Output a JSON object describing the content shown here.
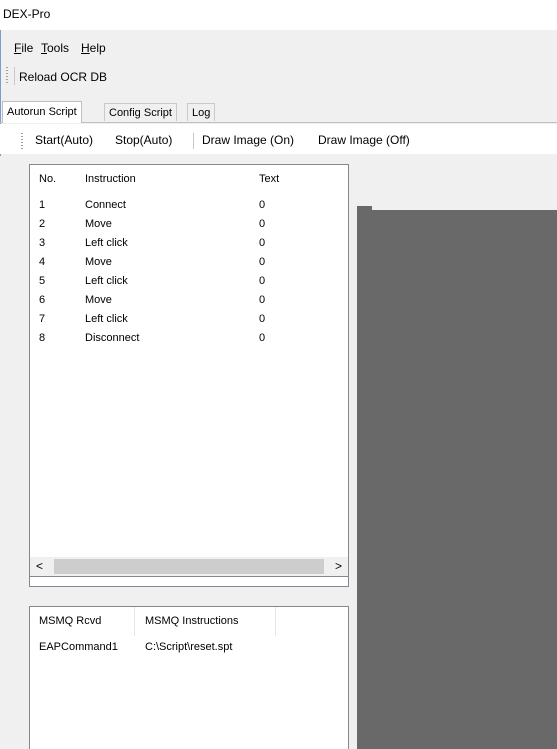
{
  "window": {
    "title": "DEX-Pro"
  },
  "menu": [
    {
      "accel": "F",
      "rest": "ile"
    },
    {
      "accel": "T",
      "rest": "ools"
    },
    {
      "accel": "H",
      "rest": "elp"
    }
  ],
  "toolbar_top": {
    "reload_label": "Reload OCR DB"
  },
  "tabs": [
    "Autorun Script",
    "Config Script",
    "Log"
  ],
  "active_tab": "Autorun Script",
  "script_toolbar": [
    "Start(Auto)",
    "Stop(Auto)",
    "Draw Image (On)",
    "Draw Image (Off)"
  ],
  "instruction_table": {
    "headers": {
      "no": "No.",
      "instruction": "Instruction",
      "text": "Text"
    },
    "rows": [
      {
        "no": "1",
        "instruction": "Connect",
        "text": "0"
      },
      {
        "no": "2",
        "instruction": "Move",
        "text": "0"
      },
      {
        "no": "3",
        "instruction": "Left click",
        "text": "0"
      },
      {
        "no": "4",
        "instruction": "Move",
        "text": "0"
      },
      {
        "no": "5",
        "instruction": "Left click",
        "text": "0"
      },
      {
        "no": "6",
        "instruction": "Move",
        "text": "0"
      },
      {
        "no": "7",
        "instruction": "Left click",
        "text": "0"
      },
      {
        "no": "8",
        "instruction": "Disconnect",
        "text": "0"
      }
    ]
  },
  "scrollbar": {
    "left_arrow": "<",
    "right_arrow": ">"
  },
  "msmq_table": {
    "headers": {
      "rcvd": "MSMQ Rcvd",
      "instructions": "MSMQ Instructions"
    },
    "rows": [
      {
        "rcvd": "EAPCommand1",
        "instructions": "C:\\Script\\reset.spt"
      }
    ]
  },
  "colors": {
    "image_area": "#696969",
    "window_border": "#7a9ccf"
  }
}
